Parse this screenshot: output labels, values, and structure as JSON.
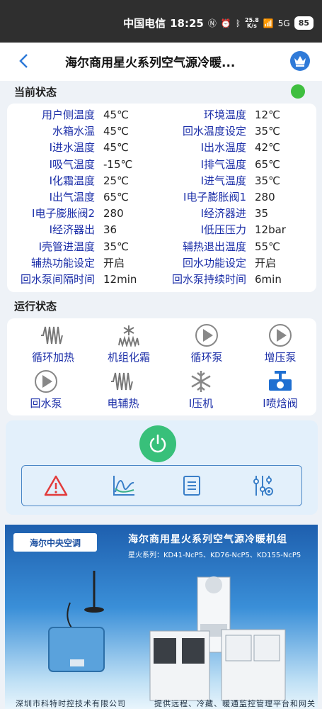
{
  "statusbar": {
    "carrier": "中国电信",
    "time": "18:25",
    "speed_top": "25.8",
    "speed_bottom": "K/s",
    "network": "5G",
    "battery": "85"
  },
  "header": {
    "title": "海尔商用星火系列空气源冷暖..."
  },
  "current_status": {
    "title": "当前状态",
    "indicator_color": "#3fbf3f",
    "rows": [
      {
        "l1": "用户侧温度",
        "v1": "45℃",
        "l2": "环境温度",
        "v2": "12℃"
      },
      {
        "l1": "水箱水温",
        "v1": "45℃",
        "l2": "回水温度设定",
        "v2": "35℃"
      },
      {
        "l1": "I进水温度",
        "v1": "45℃",
        "l2": "I出水温度",
        "v2": "42℃"
      },
      {
        "l1": "I吸气温度",
        "v1": "-15℃",
        "l2": "I排气温度",
        "v2": "65℃"
      },
      {
        "l1": "I化霜温度",
        "v1": "25℃",
        "l2": "I进气温度",
        "v2": "35℃"
      },
      {
        "l1": "I出气温度",
        "v1": "65℃",
        "l2": "I电子膨胀阀1",
        "v2": "280"
      },
      {
        "l1": "I电子膨胀阀2",
        "v1": "280",
        "l2": "I经济器进",
        "v2": "35"
      },
      {
        "l1": "I经济器出",
        "v1": "36",
        "l2": "I低压压力",
        "v2": "12bar"
      },
      {
        "l1": "I壳管进温度",
        "v1": "35℃",
        "l2": "辅热退出温度",
        "v2": "55℃"
      },
      {
        "l1": "辅热功能设定",
        "v1": "开启",
        "l2": "回水功能设定",
        "v2": "开启"
      },
      {
        "l1": "回水泵间隔时间",
        "v1": "12min",
        "l2": "回水泵持续时间",
        "v2": "6min"
      }
    ]
  },
  "run_status": {
    "title": "运行状态",
    "items": [
      {
        "label": "循环加热",
        "icon": "heater-icon"
      },
      {
        "label": "机组化霜",
        "icon": "defrost-icon"
      },
      {
        "label": "循环泵",
        "icon": "pump-icon"
      },
      {
        "label": "增压泵",
        "icon": "pump-icon"
      },
      {
        "label": "回水泵",
        "icon": "pump-icon"
      },
      {
        "label": "电辅热",
        "icon": "heater-icon"
      },
      {
        "label": "I压机",
        "icon": "snowflake-icon"
      },
      {
        "label": "I喷焓阀",
        "icon": "valve-icon"
      }
    ]
  },
  "banner": {
    "logo_text": "海尔中央空调",
    "title": "海尔商用星火系列空气源冷暖机组",
    "models": "星火系列：KD41-NcP5、KD76-NcP5、KD155-NcP5",
    "footer_left": "深圳市科特时控技术有限公司",
    "footer_right": "提供远程、冷藏、暖通监控管理平台和网关"
  },
  "colors": {
    "label_blue": "#1b2ea8",
    "power_green": "#38c07a",
    "accent_blue": "#2f7ad8"
  }
}
